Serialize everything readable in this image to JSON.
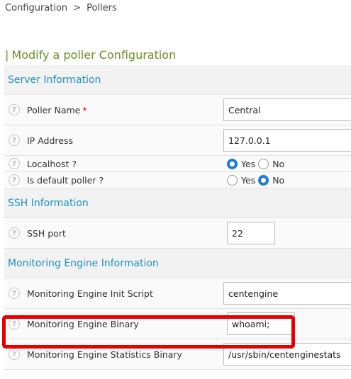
{
  "breadcrumb": {
    "items": [
      "Configuration",
      "Pollers"
    ],
    "separator": ">"
  },
  "page_title": {
    "bar": "|",
    "text": "Modify a poller Configuration"
  },
  "sections": {
    "server": "Server Information",
    "ssh": "SSH Information",
    "engine": "Monitoring Engine Information"
  },
  "fields": {
    "poller_name": {
      "label": "Poller Name",
      "required": "*",
      "value": "Central"
    },
    "ip_address": {
      "label": "IP Address",
      "value": "127.0.0.1"
    },
    "localhost": {
      "label": "Localhost ?",
      "yes": "Yes",
      "no": "No",
      "selected": "Yes"
    },
    "is_default": {
      "label": "Is default poller ?",
      "yes": "Yes",
      "no": "No",
      "selected": "No"
    },
    "ssh_port": {
      "label": "SSH port",
      "value": "22"
    },
    "init_script": {
      "label": "Monitoring Engine Init Script",
      "value": "centengine"
    },
    "engine_binary": {
      "label": "Monitoring Engine Binary",
      "value": "whoami;"
    },
    "stats_binary": {
      "label": "Monitoring Engine Statistics Binary",
      "value": "/usr/sbin/centenginestats"
    }
  },
  "help_glyph": "?",
  "colors": {
    "section_title": "#1e8fc6",
    "page_title": "#6b8e23",
    "highlight": "#e60000",
    "radio_checked": "#1e7bd0"
  }
}
